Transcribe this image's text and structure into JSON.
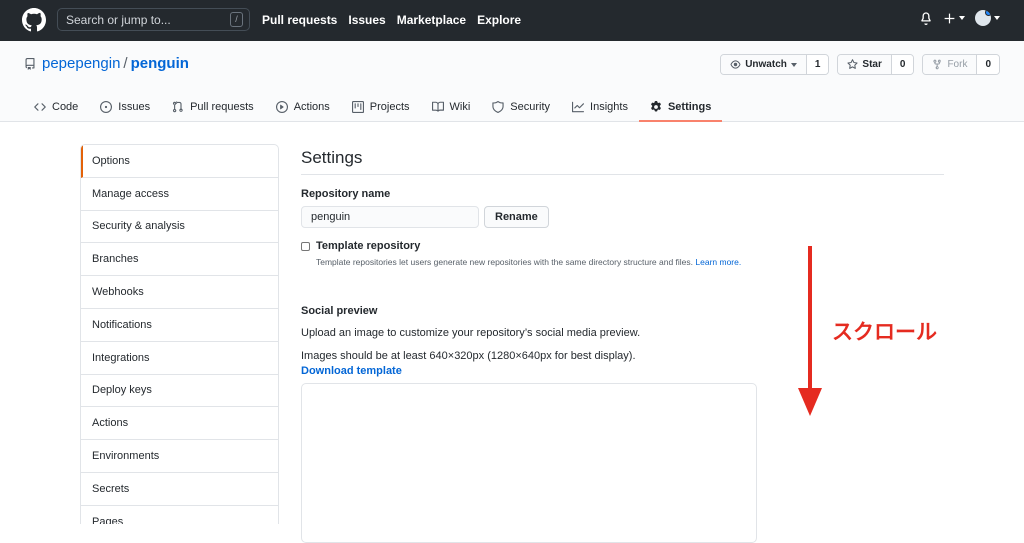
{
  "header": {
    "search_placeholder": "Search or jump to...",
    "search_key": "/",
    "nav": [
      "Pull requests",
      "Issues",
      "Marketplace",
      "Explore"
    ]
  },
  "repo": {
    "owner": "pepepengin",
    "separator": "/",
    "name": "penguin",
    "watch_label": "Unwatch",
    "watch_count": "1",
    "star_label": "Star",
    "star_count": "0",
    "fork_label": "Fork",
    "fork_count": "0"
  },
  "tabs": [
    {
      "label": "Code",
      "icon": "code-icon"
    },
    {
      "label": "Issues",
      "icon": "issue-icon"
    },
    {
      "label": "Pull requests",
      "icon": "pull-request-icon"
    },
    {
      "label": "Actions",
      "icon": "play-icon"
    },
    {
      "label": "Projects",
      "icon": "project-icon"
    },
    {
      "label": "Wiki",
      "icon": "book-icon"
    },
    {
      "label": "Security",
      "icon": "shield-icon"
    },
    {
      "label": "Insights",
      "icon": "graph-icon"
    },
    {
      "label": "Settings",
      "icon": "gear-icon",
      "active": true
    }
  ],
  "sidebar": {
    "items": [
      "Options",
      "Manage access",
      "Security & analysis",
      "Branches",
      "Webhooks",
      "Notifications",
      "Integrations",
      "Deploy keys",
      "Actions",
      "Environments",
      "Secrets",
      "Pages"
    ],
    "selected": "Options"
  },
  "settings": {
    "title": "Settings",
    "repo_name_label": "Repository name",
    "repo_name_value": "penguin",
    "rename_label": "Rename",
    "template_label": "Template repository",
    "template_note": "Template repositories let users generate new repositories with the same directory structure and files.",
    "learn_more": "Learn more.",
    "social_title": "Social preview",
    "social_desc": "Upload an image to customize your repository’s social media preview.",
    "image_note": "Images should be at least 640×320px (1280×640px for best display).",
    "download_template": "Download template"
  },
  "annotation": {
    "text": "スクロール",
    "color": "#e52b20"
  },
  "colors": {
    "header_bg": "#24292e",
    "link": "#0366d6",
    "active_tab_underline": "#f9826c",
    "sidebar_selected": "#e36209"
  }
}
